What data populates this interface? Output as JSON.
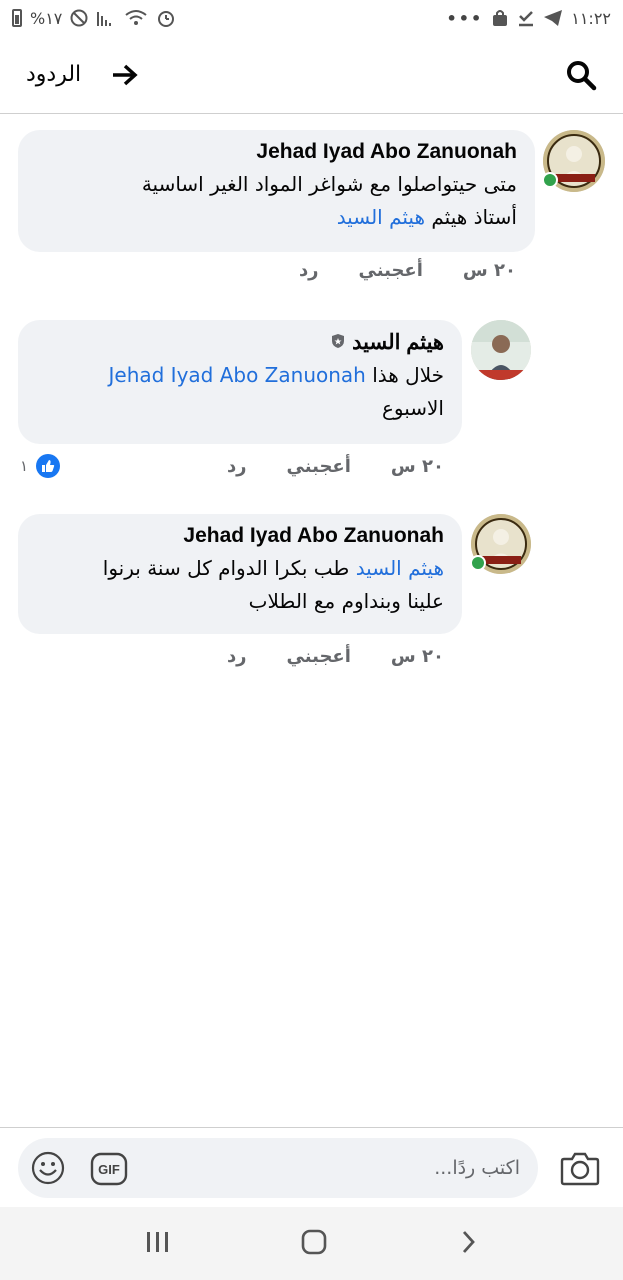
{
  "status_bar": {
    "left_text": "%١٧",
    "time": "١١:٢٢",
    "dots": "•••"
  },
  "header": {
    "title": "الردود",
    "back_icon": "arrow-right-icon",
    "search_icon": "search-icon"
  },
  "comments": [
    {
      "author": "Jehad Iyad Abo Zanuonah",
      "text_line1": "متى حيتواصلوا مع شواغر المواد الغير اساسية",
      "text_prefix": "أستاذ هيثم ",
      "mention": "هيثم السيد",
      "time": "٢٠ س",
      "like_label": "أعجبني",
      "reply_label": "رد",
      "online": true
    },
    {
      "author": "هيثم السيد",
      "text_prefix": "خلال هذا ",
      "mention": "Jehad Iyad Abo Zanuonah",
      "text_suffix": "الاسبوع",
      "time": "٢٠ س",
      "like_label": "أعجبني",
      "reply_label": "رد",
      "reaction_count": "١",
      "badge_icon": "shield-badge-icon"
    },
    {
      "author": "Jehad Iyad Abo Zanuonah",
      "mention": "هيثم السيد",
      "text_after_mention": " طب بكرا الدوام كل سنة برنوا",
      "text_line2": "علينا وبنداوم مع الطلاب",
      "time": "٢٠ س",
      "like_label": "أعجبني",
      "reply_label": "رد",
      "online": true
    }
  ],
  "composer": {
    "placeholder": "اكتب ردًا...",
    "gif_label": "GIF"
  },
  "colors": {
    "mention": "#216fdb",
    "bubble": "#f0f2f5",
    "online": "#31a24c",
    "like": "#1877f2"
  }
}
